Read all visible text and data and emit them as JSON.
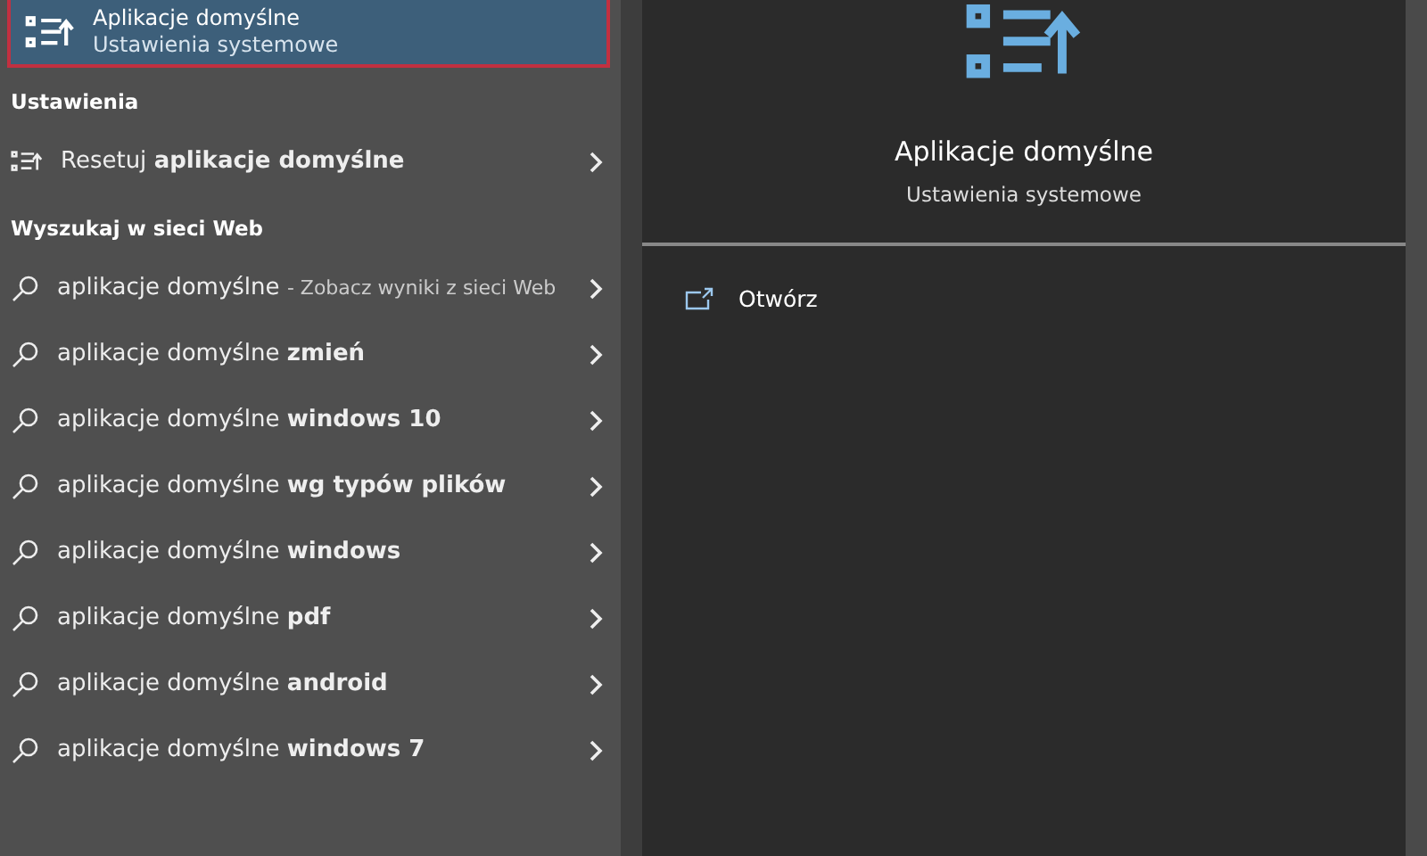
{
  "best_match": {
    "title": "Aplikacje domyślne",
    "subtitle": "Ustawienia systemowe",
    "selected": true
  },
  "sections": [
    {
      "heading": "Ustawienia",
      "items": [
        {
          "kind": "setting",
          "text": "Resetuj **aplikacje domyślne**"
        }
      ]
    },
    {
      "heading": "Wyszukaj w sieci Web",
      "items": [
        {
          "kind": "web",
          "text": "aplikacje domyślne",
          "hint": "- Zobacz wyniki z sieci Web"
        },
        {
          "kind": "web",
          "text": "aplikacje domyślne **zmień**"
        },
        {
          "kind": "web",
          "text": "aplikacje domyślne **windows 10**"
        },
        {
          "kind": "web",
          "text": "aplikacje domyślne **wg typów plików**"
        },
        {
          "kind": "web",
          "text": "aplikacje domyślne **windows**"
        },
        {
          "kind": "web",
          "text": "aplikacje domyślne **pdf**"
        },
        {
          "kind": "web",
          "text": "aplikacje domyślne **android**"
        },
        {
          "kind": "web",
          "text": "aplikacje domyślne **windows 7**"
        }
      ]
    }
  ],
  "preview": {
    "title": "Aplikacje domyślne",
    "subtitle": "Ustawienia systemowe",
    "actions": [
      {
        "label": "Otwórz"
      }
    ]
  }
}
